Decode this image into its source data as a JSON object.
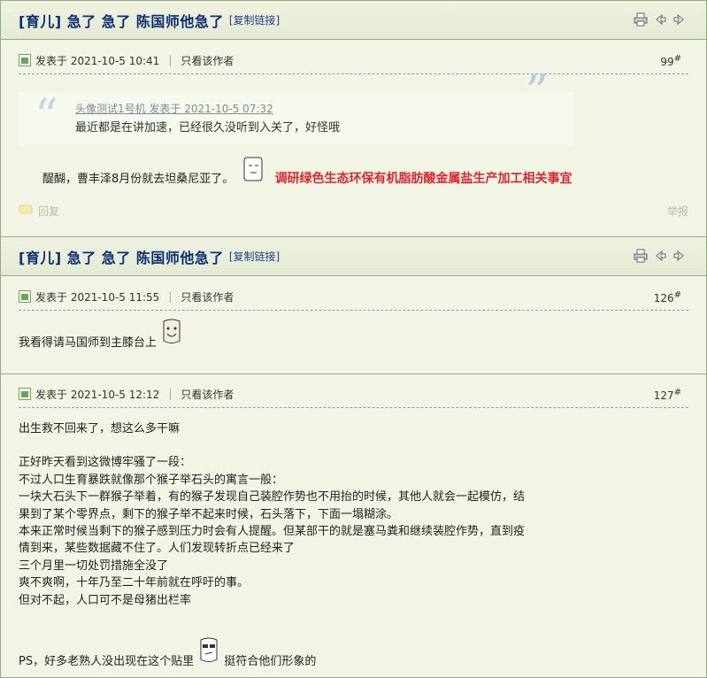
{
  "threads": [
    {
      "title_tag": "[育儿]",
      "title": "急了 急了 陈国师他急了",
      "copy_link": "[复制链接]",
      "posts": [
        {
          "posted": "发表于 2021-10-5 10:41",
          "only_author": "只看该作者",
          "floor": "99",
          "floor_mark": "#",
          "quote_author": "头像测试1号机 发表于 2021-10-5 07:32",
          "quote_text": "最近都是在讲加速，已经很久没听到入关了，好怪哦",
          "body_text": "醍醐，曹丰泽8月份就去坦桑尼亚了。",
          "ad_link": "调研绿色生态环保有机脂肪酸金属盐生产加工相关事宜",
          "reply": "回复",
          "report": "举报"
        }
      ]
    },
    {
      "title_tag": "[育儿]",
      "title": "急了 急了 陈国师他急了",
      "copy_link": "[复制链接]",
      "posts": [
        {
          "posted": "发表于 2021-10-5 11:55",
          "only_author": "只看该作者",
          "floor": "126",
          "floor_mark": "#",
          "body_text": "我看得请马国师到主膝台上"
        },
        {
          "posted": "发表于 2021-10-5 12:12",
          "only_author": "只看该作者",
          "floor": "127",
          "floor_mark": "#",
          "lines": [
            "出生救不回来了，想这么多干嘛",
            "",
            "正好昨天看到这微博牢骚了一段：",
            "不过人口生育暴跌就像那个猴子举石头的寓言一般：",
            "一块大石头下一群猴子举着，有的猴子发现自己装腔作势也不用抬的时候，其他人就会一起模仿，结",
            "果到了某个零界点，剩下的猴子举不起来时候，石头落下，下面一塌糊涂。",
            "本来正常时候当剩下的猴子感到压力时会有人提醒。但某部干的就是塞马粪和继续装腔作势，直到疫",
            "情到来，某些数据藏不住了。人们发现转折点已经来了",
            "三个月里一切处罚措施全没了",
            "爽不爽啊，十年乃至二十年前就在呼吁的事。",
            "但对不起，人口可不是母猪出栏率",
            ""
          ],
          "ps_text": "PS，好多老熟人没出现在这个贴里",
          "ps_tail": "挺符合他们形象的"
        }
      ]
    }
  ]
}
